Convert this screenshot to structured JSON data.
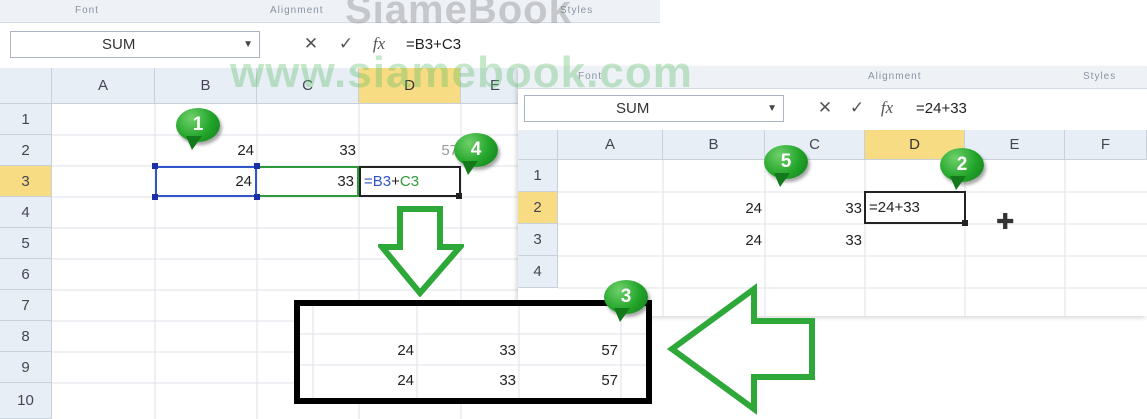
{
  "watermark": {
    "top": "SiameBook",
    "site": "www.siamebook.com"
  },
  "left": {
    "ribbon_labels": [
      "Font",
      "Alignment",
      "Styles"
    ],
    "name_box": "SUM",
    "formula": "=B3+C3",
    "columns": [
      "A",
      "B",
      "C",
      "D",
      "E"
    ],
    "rows": [
      "1",
      "2",
      "3",
      "4",
      "5",
      "6",
      "7",
      "8",
      "9",
      "10"
    ],
    "cells": {
      "B2": "24",
      "C2": "33",
      "D2": "57",
      "B3": "24",
      "C3": "33",
      "D3_ref1": "=B3",
      "D3_op": "+",
      "D3_ref2": "C3"
    }
  },
  "right": {
    "ribbon_labels": [
      "Font",
      "Alignment",
      "Styles"
    ],
    "name_box": "SUM",
    "formula": "=24+33",
    "columns": [
      "A",
      "B",
      "C",
      "D",
      "E",
      "F"
    ],
    "rows": [
      "1",
      "2",
      "3",
      "4"
    ],
    "cells": {
      "B2": "24",
      "C2": "33",
      "D2": "=24+33",
      "B3": "24",
      "C3": "33"
    }
  },
  "result_box": {
    "row1": [
      "24",
      "33",
      "57"
    ],
    "row2": [
      "24",
      "33",
      "57"
    ]
  },
  "callouts": [
    "1",
    "2",
    "3",
    "4",
    "5"
  ],
  "icons": {
    "cancel": "✕",
    "enter": "✓",
    "fx": "fx",
    "dropdown": "▼",
    "cursor": "✚"
  },
  "colors": {
    "accent_green": "#22a52a",
    "ref_blue": "#3355cc",
    "ref_green": "#2e9a3a"
  }
}
